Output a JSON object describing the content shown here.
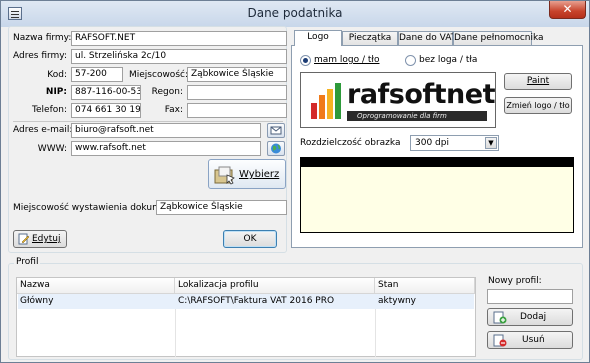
{
  "window": {
    "title": "Dane podatnika",
    "close": "✕"
  },
  "form": {
    "company_label": "Nazwa firmy:",
    "company_value": "RAFSOFT.NET",
    "address_label": "Adres firmy:",
    "address_value": "ul. Strzelińska 2c/10",
    "code_label": "Kod:",
    "code_value": "57-200",
    "city_label": "Miejscowość:",
    "city_value": "Ząbkowice Śląskie",
    "nip_label": "NIP:",
    "nip_value": "887-116-00-53",
    "regon_label": "Regon:",
    "regon_value": "",
    "phone_label": "Telefon:",
    "phone_value": "074 661 30 19",
    "fax_label": "Fax:",
    "fax_value": "",
    "email_label": "Adres e-mail:",
    "email_value": "biuro@rafsoft.net",
    "www_label": "WWW:",
    "www_value": "www.rafsoft.net",
    "choose_button": "Wybierz",
    "issue_place_label": "Miejscowość wystawienia dokumentu:",
    "issue_place_value": "Ząbkowice Śląskie",
    "edit_button": "Edytuj",
    "ok_button": "OK"
  },
  "tabs": [
    {
      "label": "Logo"
    },
    {
      "label": "Pieczątka"
    },
    {
      "label": "Dane do VAT"
    },
    {
      "label": "Dane pełnomocnika"
    }
  ],
  "logo_tab": {
    "radio_with_logo": "mam logo / tło",
    "radio_without_logo": "bez loga / tła",
    "logo_name": "rafsoftnet",
    "logo_tagline": "Oprogramowanie dla firm",
    "paint_button": "Paint",
    "change_logo_button": "Zmień logo / tło",
    "resolution_label": "Rozdzielczość obrazka",
    "resolution_value": "300 dpi"
  },
  "profile": {
    "group_label": "Profil",
    "columns": [
      "Nazwa",
      "Lokalizacja profilu",
      "Stan"
    ],
    "rows": [
      {
        "name": "Główny",
        "location": "C:\\RAFSOFT\\Faktura VAT 2016 PRO",
        "status": "aktywny"
      }
    ],
    "new_profile_label": "Nowy profil:",
    "new_profile_value": "",
    "add_button": "Dodaj",
    "delete_button": "Usuń"
  },
  "colors": {
    "logo_orange": "#f07a1a",
    "logo_green": "#2e9a3a",
    "logo_red": "#d42b2b"
  }
}
